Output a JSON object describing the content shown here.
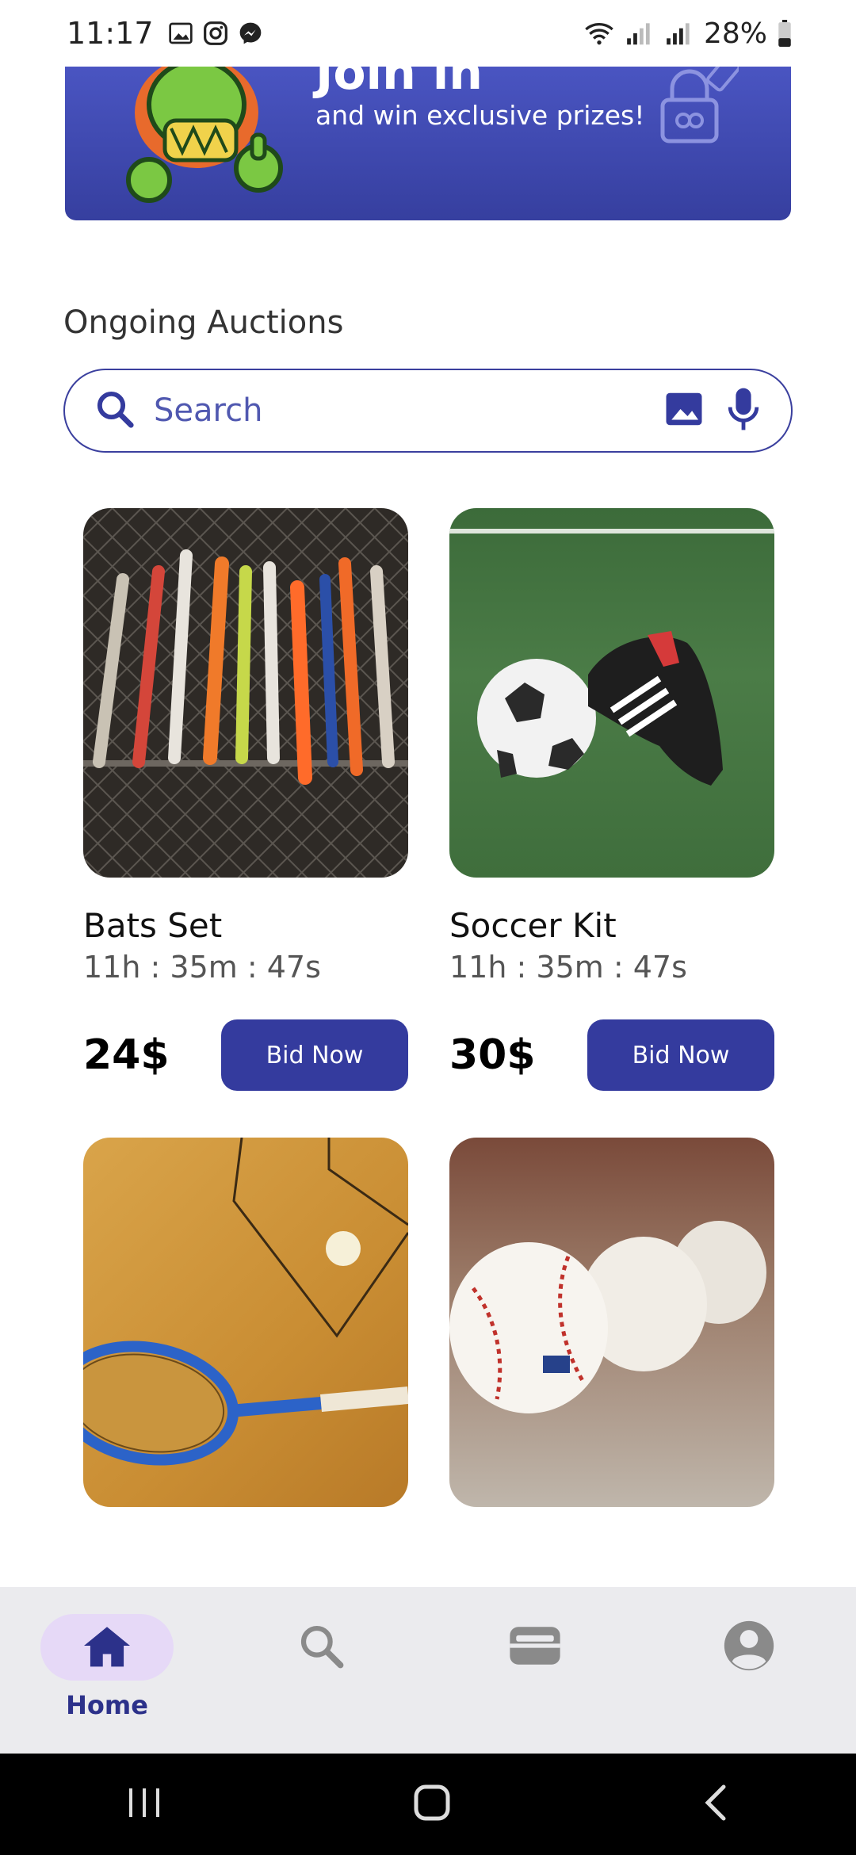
{
  "status_bar": {
    "time": "11:17",
    "battery": "28%",
    "icons": [
      "gallery-icon",
      "instagram-icon",
      "messenger-icon",
      "wifi-icon",
      "signal-icon",
      "battery-icon"
    ]
  },
  "banner": {
    "title": "Join in",
    "subtitle": "and win exclusive prizes!"
  },
  "section": {
    "title": "Ongoing Auctions"
  },
  "search": {
    "placeholder": "Search",
    "value": ""
  },
  "products": [
    {
      "title": "Bats Set",
      "timer": "11h : 35m : 47s",
      "price": "24$",
      "bid_label": "Bid Now"
    },
    {
      "title": "Soccer Kit",
      "timer": "11h : 35m : 47s",
      "price": "30$",
      "bid_label": "Bid Now"
    },
    {
      "title": "",
      "timer": "",
      "price": "",
      "bid_label": ""
    },
    {
      "title": "",
      "timer": "",
      "price": "",
      "bid_label": ""
    }
  ],
  "bottom_nav": {
    "home_label": "Home",
    "items": [
      "home",
      "search",
      "wallet",
      "profile"
    ]
  },
  "colors": {
    "primary": "#343b9e",
    "banner_top": "#4a55c2",
    "nav_active_bg": "#e6d9f7",
    "nav_bg": "#ebebee"
  }
}
